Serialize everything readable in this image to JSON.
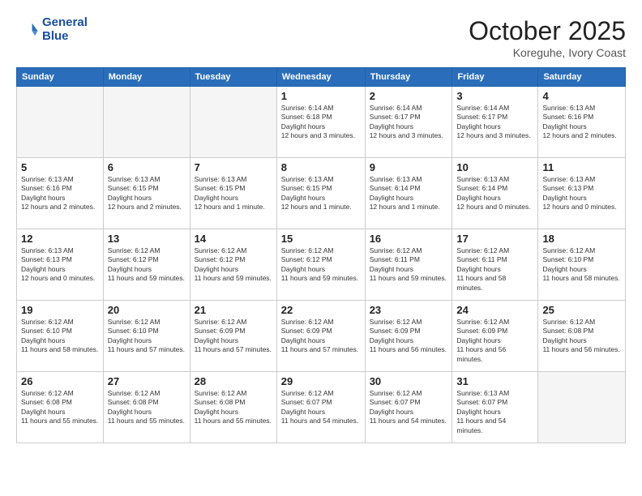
{
  "logo": {
    "line1": "General",
    "line2": "Blue"
  },
  "title": "October 2025",
  "location": "Koreguhe, Ivory Coast",
  "weekdays": [
    "Sunday",
    "Monday",
    "Tuesday",
    "Wednesday",
    "Thursday",
    "Friday",
    "Saturday"
  ],
  "weeks": [
    [
      {
        "day": "",
        "empty": true
      },
      {
        "day": "",
        "empty": true
      },
      {
        "day": "",
        "empty": true
      },
      {
        "day": "1",
        "sunrise": "6:14 AM",
        "sunset": "6:18 PM",
        "daylight": "12 hours and 3 minutes."
      },
      {
        "day": "2",
        "sunrise": "6:14 AM",
        "sunset": "6:17 PM",
        "daylight": "12 hours and 3 minutes."
      },
      {
        "day": "3",
        "sunrise": "6:14 AM",
        "sunset": "6:17 PM",
        "daylight": "12 hours and 3 minutes."
      },
      {
        "day": "4",
        "sunrise": "6:13 AM",
        "sunset": "6:16 PM",
        "daylight": "12 hours and 2 minutes."
      }
    ],
    [
      {
        "day": "5",
        "sunrise": "6:13 AM",
        "sunset": "6:16 PM",
        "daylight": "12 hours and 2 minutes."
      },
      {
        "day": "6",
        "sunrise": "6:13 AM",
        "sunset": "6:15 PM",
        "daylight": "12 hours and 2 minutes."
      },
      {
        "day": "7",
        "sunrise": "6:13 AM",
        "sunset": "6:15 PM",
        "daylight": "12 hours and 1 minute."
      },
      {
        "day": "8",
        "sunrise": "6:13 AM",
        "sunset": "6:15 PM",
        "daylight": "12 hours and 1 minute."
      },
      {
        "day": "9",
        "sunrise": "6:13 AM",
        "sunset": "6:14 PM",
        "daylight": "12 hours and 1 minute."
      },
      {
        "day": "10",
        "sunrise": "6:13 AM",
        "sunset": "6:14 PM",
        "daylight": "12 hours and 0 minutes."
      },
      {
        "day": "11",
        "sunrise": "6:13 AM",
        "sunset": "6:13 PM",
        "daylight": "12 hours and 0 minutes."
      }
    ],
    [
      {
        "day": "12",
        "sunrise": "6:13 AM",
        "sunset": "6:13 PM",
        "daylight": "12 hours and 0 minutes."
      },
      {
        "day": "13",
        "sunrise": "6:12 AM",
        "sunset": "6:12 PM",
        "daylight": "11 hours and 59 minutes."
      },
      {
        "day": "14",
        "sunrise": "6:12 AM",
        "sunset": "6:12 PM",
        "daylight": "11 hours and 59 minutes."
      },
      {
        "day": "15",
        "sunrise": "6:12 AM",
        "sunset": "6:12 PM",
        "daylight": "11 hours and 59 minutes."
      },
      {
        "day": "16",
        "sunrise": "6:12 AM",
        "sunset": "6:11 PM",
        "daylight": "11 hours and 59 minutes."
      },
      {
        "day": "17",
        "sunrise": "6:12 AM",
        "sunset": "6:11 PM",
        "daylight": "11 hours and 58 minutes."
      },
      {
        "day": "18",
        "sunrise": "6:12 AM",
        "sunset": "6:10 PM",
        "daylight": "11 hours and 58 minutes."
      }
    ],
    [
      {
        "day": "19",
        "sunrise": "6:12 AM",
        "sunset": "6:10 PM",
        "daylight": "11 hours and 58 minutes."
      },
      {
        "day": "20",
        "sunrise": "6:12 AM",
        "sunset": "6:10 PM",
        "daylight": "11 hours and 57 minutes."
      },
      {
        "day": "21",
        "sunrise": "6:12 AM",
        "sunset": "6:09 PM",
        "daylight": "11 hours and 57 minutes."
      },
      {
        "day": "22",
        "sunrise": "6:12 AM",
        "sunset": "6:09 PM",
        "daylight": "11 hours and 57 minutes."
      },
      {
        "day": "23",
        "sunrise": "6:12 AM",
        "sunset": "6:09 PM",
        "daylight": "11 hours and 56 minutes."
      },
      {
        "day": "24",
        "sunrise": "6:12 AM",
        "sunset": "6:09 PM",
        "daylight": "11 hours and 56 minutes."
      },
      {
        "day": "25",
        "sunrise": "6:12 AM",
        "sunset": "6:08 PM",
        "daylight": "11 hours and 56 minutes."
      }
    ],
    [
      {
        "day": "26",
        "sunrise": "6:12 AM",
        "sunset": "6:08 PM",
        "daylight": "11 hours and 55 minutes."
      },
      {
        "day": "27",
        "sunrise": "6:12 AM",
        "sunset": "6:08 PM",
        "daylight": "11 hours and 55 minutes."
      },
      {
        "day": "28",
        "sunrise": "6:12 AM",
        "sunset": "6:08 PM",
        "daylight": "11 hours and 55 minutes."
      },
      {
        "day": "29",
        "sunrise": "6:12 AM",
        "sunset": "6:07 PM",
        "daylight": "11 hours and 54 minutes."
      },
      {
        "day": "30",
        "sunrise": "6:12 AM",
        "sunset": "6:07 PM",
        "daylight": "11 hours and 54 minutes."
      },
      {
        "day": "31",
        "sunrise": "6:13 AM",
        "sunset": "6:07 PM",
        "daylight": "11 hours and 54 minutes."
      },
      {
        "day": "",
        "empty": true
      }
    ]
  ]
}
